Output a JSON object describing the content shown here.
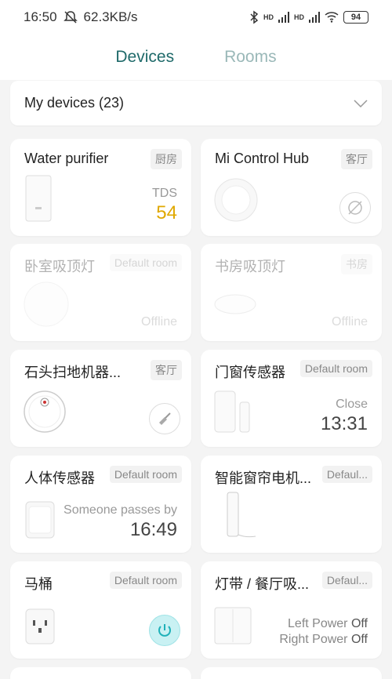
{
  "status_bar": {
    "time": "16:50",
    "speed": "62.3KB/s",
    "signal1": "HD",
    "signal2": "HD",
    "battery": "94"
  },
  "tabs": [
    {
      "label": "Devices",
      "active": true
    },
    {
      "label": "Rooms",
      "active": false
    }
  ],
  "my_devices": {
    "label": "My devices (23)"
  },
  "devices": [
    {
      "name": "Water purifier",
      "room": "厨房",
      "status_label": "TDS",
      "status_value": "54"
    },
    {
      "name": "Mi Control Hub",
      "room": "客厅"
    },
    {
      "name": "卧室吸顶灯",
      "room": "Default room",
      "status": "Offline"
    },
    {
      "name": "书房吸顶灯",
      "room": "书房",
      "status": "Offline"
    },
    {
      "name": "石头扫地机器...",
      "room": "客厅"
    },
    {
      "name": "门窗传感器",
      "room": "Default room",
      "status_label": "Close",
      "status_value": "13:31"
    },
    {
      "name": "人体传感器",
      "room": "Default room",
      "status_label": "Someone passes by",
      "status_value": "16:49"
    },
    {
      "name": "智能窗帘电机...",
      "room": "Defaul..."
    },
    {
      "name": "马桶",
      "room": "Default room"
    },
    {
      "name": "灯带 / 餐厅吸...",
      "room": "Defaul...",
      "left_label": "Left Power",
      "left_value": "Off",
      "right_label": "Right Power",
      "right_value": "Off"
    }
  ],
  "colors": {
    "tab_active": "#1f6a6a",
    "tab_inactive": "#9ab8b8",
    "tds": "#e0a800",
    "power_on": "#c9f1f3"
  }
}
